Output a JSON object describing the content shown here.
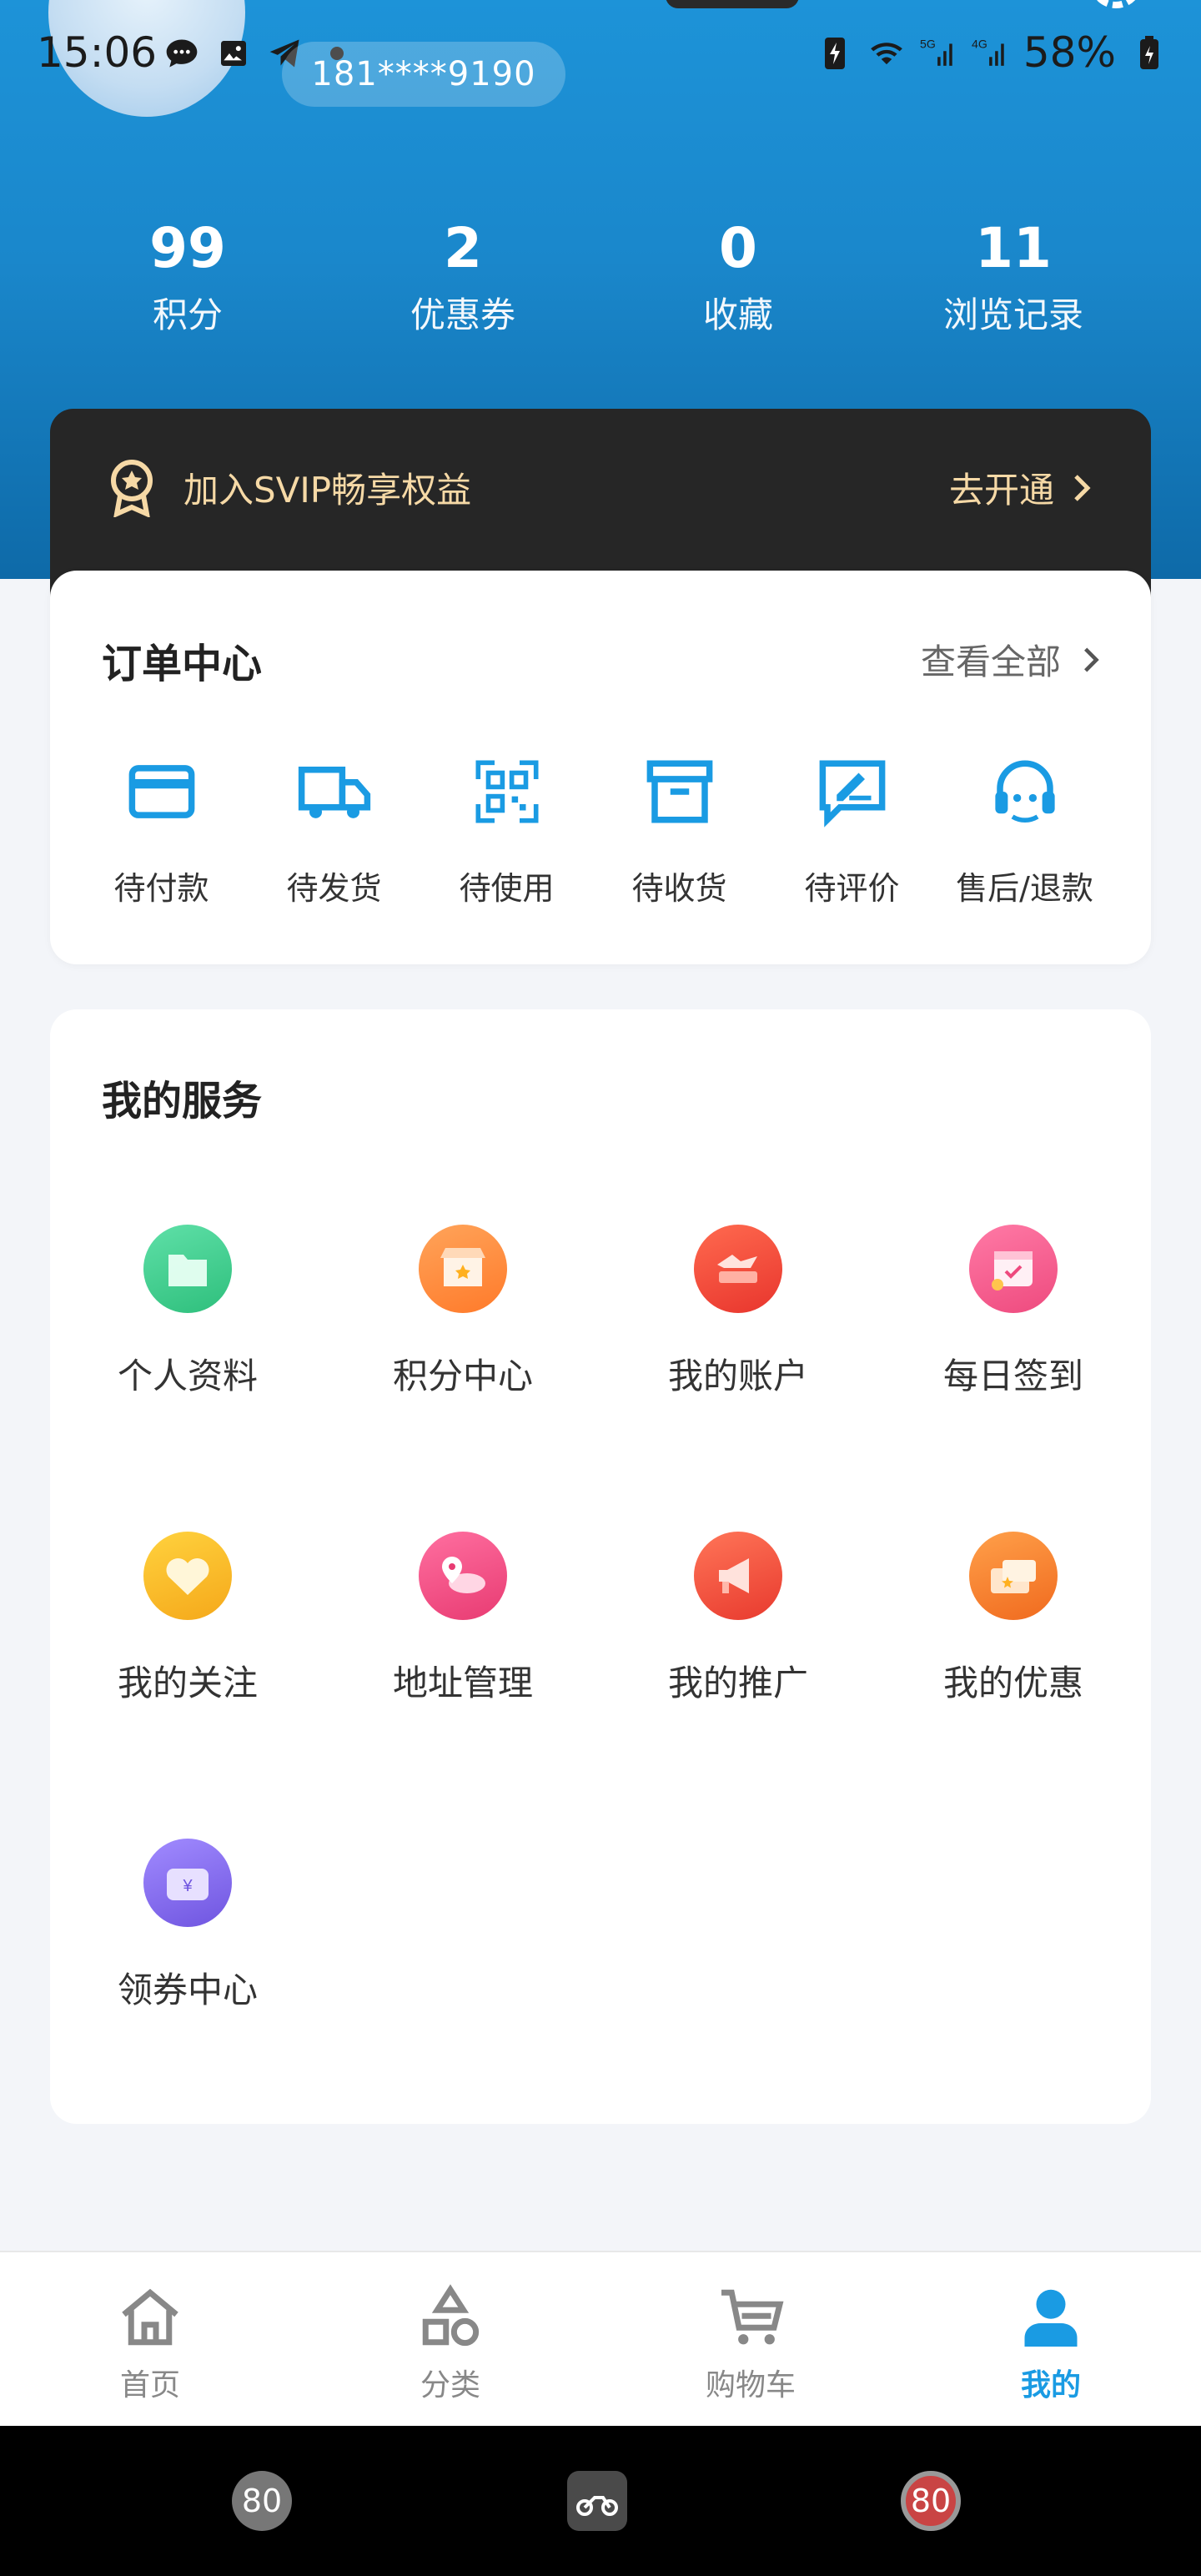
{
  "status_bar": {
    "time": "15:06",
    "battery": "58%"
  },
  "profile": {
    "phone": "181****9190"
  },
  "stats": [
    {
      "value": "99",
      "label": "积分"
    },
    {
      "value": "2",
      "label": "优惠券"
    },
    {
      "value": "0",
      "label": "收藏"
    },
    {
      "value": "11",
      "label": "浏览记录"
    }
  ],
  "svip": {
    "text": "加入SVIP畅享权益",
    "action": "去开通"
  },
  "orders": {
    "title": "订单中心",
    "view_all": "查看全部",
    "items": [
      {
        "label": "待付款",
        "icon": "card-icon"
      },
      {
        "label": "待发货",
        "icon": "truck-icon"
      },
      {
        "label": "待使用",
        "icon": "qr-code-icon"
      },
      {
        "label": "待收货",
        "icon": "box-icon"
      },
      {
        "label": "待评价",
        "icon": "comment-edit-icon"
      },
      {
        "label": "售后/退款",
        "icon": "headset-icon"
      }
    ]
  },
  "services": {
    "title": "我的服务",
    "items": [
      {
        "label": "个人资料",
        "icon": "folder-icon",
        "color": "#3fcf8e"
      },
      {
        "label": "积分中心",
        "icon": "store-icon",
        "color": "#ff8a3d"
      },
      {
        "label": "我的账户",
        "icon": "account-icon",
        "color": "#f04a3a"
      },
      {
        "label": "每日签到",
        "icon": "calendar-icon",
        "color": "#f25a8e"
      },
      {
        "label": "我的关注",
        "icon": "heart-icon",
        "color": "#f6b71c"
      },
      {
        "label": "地址管理",
        "icon": "location-icon",
        "color": "#f0507f"
      },
      {
        "label": "我的推广",
        "icon": "megaphone-icon",
        "color": "#f4503e"
      },
      {
        "label": "我的优惠",
        "icon": "coupon-icon",
        "color": "#f6832a"
      },
      {
        "label": "领券中心",
        "icon": "wallet-icon",
        "color": "#8a6ef0"
      }
    ]
  },
  "tabbar": {
    "items": [
      {
        "label": "首页",
        "icon": "home-icon"
      },
      {
        "label": "分类",
        "icon": "category-icon"
      },
      {
        "label": "购物车",
        "icon": "cart-icon"
      },
      {
        "label": "我的",
        "icon": "user-icon"
      }
    ],
    "active_color": "#1a9be3"
  },
  "nav_bar": {
    "speed_label": "80"
  }
}
